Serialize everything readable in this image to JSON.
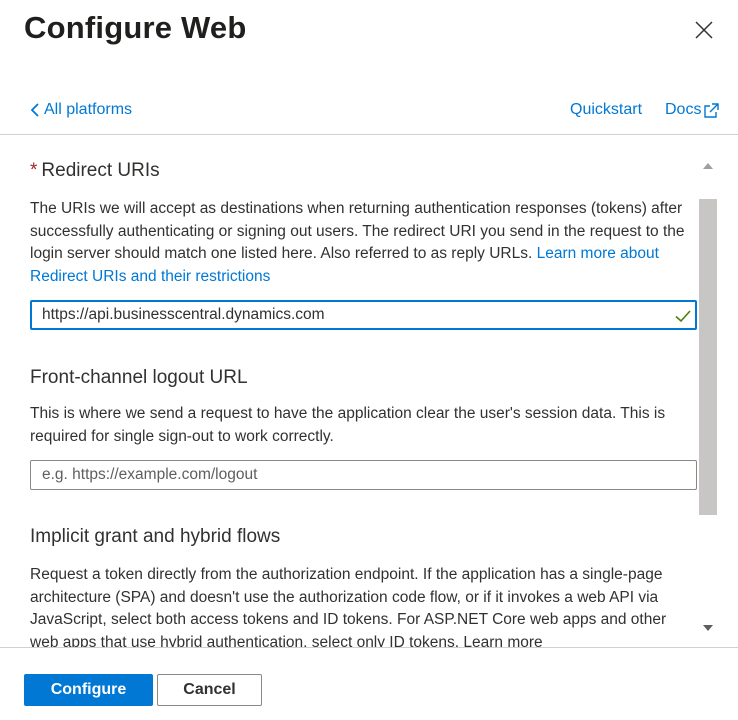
{
  "panel": {
    "title": "Configure Web",
    "close_icon": "close-icon"
  },
  "nav": {
    "back_label": "All platforms",
    "quickstart_label": "Quickstart",
    "docs_label": "Docs"
  },
  "redirect": {
    "required_marker": "*",
    "title": "Redirect URIs",
    "description": "The URIs we will accept as destinations when returning authentication responses (tokens) after successfully authenticating or signing out users. The redirect URI you send in the request to the login server should match one listed here. Also referred to as reply URLs.",
    "learn_more": "Learn more about Redirect URIs and their restrictions",
    "value": "https://api.businesscentral.dynamics.com",
    "valid_color": "#498205"
  },
  "logout": {
    "title": "Front-channel logout URL",
    "description": "This is where we send a request to have the application clear the user's session data. This is required for single sign-out to work correctly.",
    "placeholder": "e.g. https://example.com/logout"
  },
  "implicit": {
    "title": "Implicit grant and hybrid flows",
    "description": "Request a token directly from the authorization endpoint. If the application has a single-page architecture (SPA) and doesn't use the authorization code flow, or if it invokes a web API via JavaScript, select both access tokens and ID tokens. For ASP.NET Core web apps and other web apps that use hybrid authentication, select only ID tokens. Learn more"
  },
  "footer": {
    "configure_label": "Configure",
    "cancel_label": "Cancel"
  },
  "colors": {
    "accent": "#0078d4",
    "required": "#a4262c"
  }
}
